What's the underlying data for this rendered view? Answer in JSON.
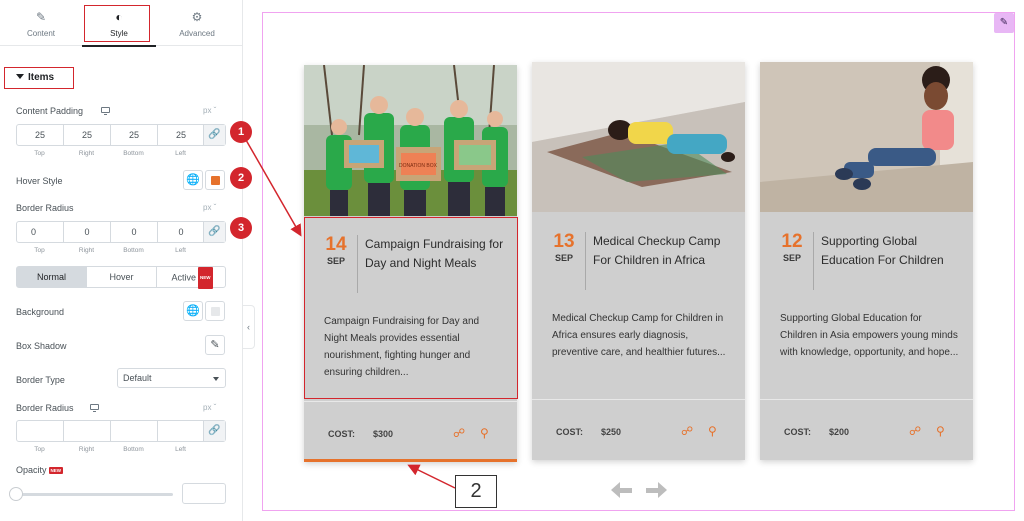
{
  "tabs": [
    {
      "label": "Content",
      "icon": "pencil-icon"
    },
    {
      "label": "Style",
      "icon": "contrast-icon"
    },
    {
      "label": "Advanced",
      "icon": "gear-icon"
    }
  ],
  "section": {
    "title": "Items"
  },
  "content_padding": {
    "label": "Content Padding",
    "unit": "px",
    "values": [
      "25",
      "25",
      "25",
      "25"
    ],
    "sides": [
      "Top",
      "Right",
      "Bottom",
      "Left"
    ]
  },
  "hover_style": {
    "label": "Hover Style",
    "swatch_color": "#e6722c"
  },
  "border_radius_1": {
    "label": "Border Radius",
    "unit": "px",
    "values": [
      "0",
      "0",
      "0",
      "0"
    ],
    "sides": [
      "Top",
      "Right",
      "Bottom",
      "Left"
    ]
  },
  "state_tabs": {
    "normal": "Normal",
    "hover": "Hover",
    "active": "Active",
    "new_tag": "NEW"
  },
  "background": {
    "label": "Background"
  },
  "box_shadow": {
    "label": "Box Shadow"
  },
  "border_type": {
    "label": "Border Type",
    "value": "Default"
  },
  "border_radius_2": {
    "label": "Border Radius",
    "unit": "px",
    "sides": [
      "Top",
      "Right",
      "Bottom",
      "Left"
    ]
  },
  "opacity": {
    "label": "Opacity",
    "new_tag": "NEW"
  },
  "badges": [
    "1",
    "2",
    "3"
  ],
  "callout": "2",
  "cards": [
    {
      "day": "14",
      "month": "SEP",
      "title": "Campaign Fundraising for Day and Night Meals",
      "desc": "Campaign Fundraising for Day and Night Meals provides essential nourishment, fighting hunger and ensuring children...",
      "cost_label": "COST:",
      "price": "$300"
    },
    {
      "day": "13",
      "month": "SEP",
      "title": "Medical Checkup Camp For Children in Africa",
      "desc": "Medical Checkup Camp for Children in Africa ensures early diagnosis, preventive care, and healthier futures...",
      "cost_label": "COST:",
      "price": "$250"
    },
    {
      "day": "12",
      "month": "SEP",
      "title": "Supporting Global Education For Children",
      "desc": "Supporting Global Education for Children in Asia empowers young minds with knowledge, opportunity, and hope...",
      "cost_label": "COST:",
      "price": "$200"
    }
  ],
  "volunteer_signs": [
    "DONATION BOX"
  ],
  "colors": {
    "accent": "#e6722c",
    "annotation_red": "#d3262d",
    "card_bg": "#cfcfcf"
  }
}
